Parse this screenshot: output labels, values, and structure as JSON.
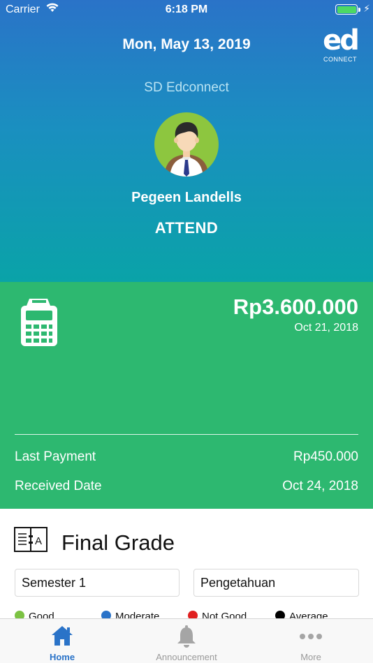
{
  "status_bar": {
    "carrier": "Carrier",
    "time": "6:18 PM"
  },
  "header": {
    "date": "Mon, May 13, 2019",
    "logo_text": "ed",
    "logo_subtext": "CONNECT",
    "school_name": "SD Edconnect",
    "student_name": "Pegeen Landells",
    "attendance_status": "ATTEND"
  },
  "payment": {
    "icon": "calculator-icon",
    "amount": "Rp3.600.000",
    "due_date": "Oct 21, 2018",
    "last_payment_label": "Last Payment",
    "last_payment_value": "Rp450.000",
    "received_date_label": "Received Date",
    "received_date_value": "Oct 24, 2018"
  },
  "final_grade": {
    "icon": "book-icon",
    "title": "Final Grade",
    "semester_select": "Semester 1",
    "category_select": "Pengetahuan",
    "legend": [
      {
        "label": "Good",
        "color": "#7cc243"
      },
      {
        "label": "Moderate",
        "color": "#2a73c8"
      },
      {
        "label": "Not Good",
        "color": "#e02020"
      },
      {
        "label": "Average",
        "color": "#000000"
      }
    ]
  },
  "tab_bar": {
    "home": "Home",
    "announcement": "Announcement",
    "more": "More"
  },
  "colors": {
    "header_top": "#2a73c8",
    "header_bottom": "#0aa3a8",
    "payment_bg": "#2db870",
    "active_tab": "#2a73c8"
  }
}
